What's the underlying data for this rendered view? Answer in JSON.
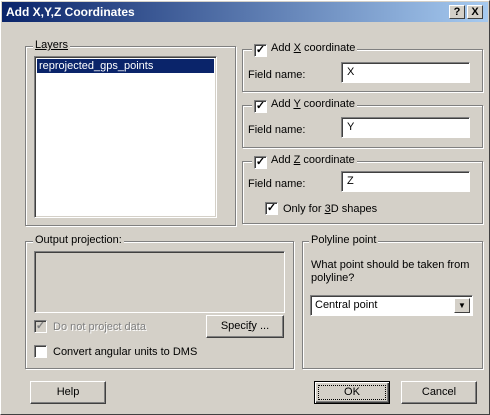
{
  "window": {
    "title": "Add X,Y,Z Coordinates",
    "help_glyph": "?",
    "close_glyph": "X"
  },
  "layers": {
    "label": "Layers",
    "items": [
      "reprojected_gps_points"
    ]
  },
  "x": {
    "label_pre": "Add ",
    "label_key": "X",
    "label_post": " coordinate",
    "checked": true,
    "field_label": "Field name:",
    "field_value": "X"
  },
  "y": {
    "label_pre": "Add ",
    "label_key": "Y",
    "label_post": " coordinate",
    "checked": true,
    "field_label": "Field name:",
    "field_value": "Y"
  },
  "z": {
    "label_pre": "Add ",
    "label_key": "Z",
    "label_post": " coordinate",
    "checked": true,
    "field_label": "Field name:",
    "field_value": "Z"
  },
  "only3d": {
    "label_pre": "Only for ",
    "label_key": "3",
    "label_post": "D shapes",
    "checked": true
  },
  "output": {
    "label": "Output projection:",
    "dont_project": "Do not project data",
    "specify_pre": "Speci",
    "specify_key": "f",
    "specify_post": "y ...",
    "convert": "Convert angular units to DMS"
  },
  "polyline": {
    "label": "Polyline point",
    "question": "What point should be taken from polyline?",
    "selected": "Central point"
  },
  "buttons": {
    "help": "Help",
    "ok": "OK",
    "cancel": "Cancel"
  },
  "check_glyph": "✓"
}
